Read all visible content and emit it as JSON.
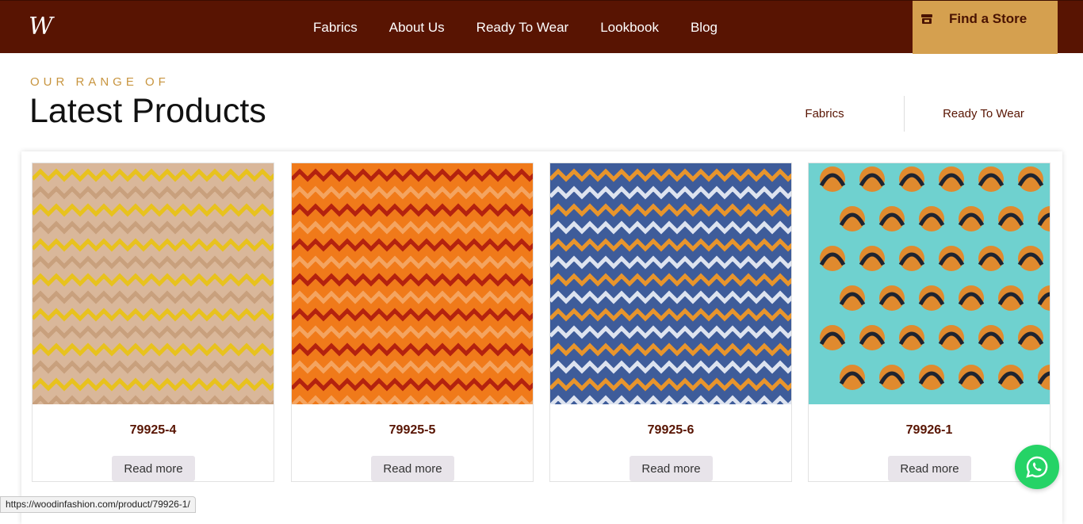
{
  "header": {
    "logo_text": "W",
    "nav": [
      "Fabrics",
      "About Us",
      "Ready To Wear",
      "Lookbook",
      "Blog"
    ],
    "store_button": "Find a Store",
    "store_icon": "store-icon"
  },
  "section": {
    "eyebrow": "OUR RANGE OF",
    "title": "Latest Products",
    "filters": [
      "Fabrics",
      "Ready To Wear"
    ]
  },
  "products": [
    {
      "name": "79925-4",
      "button": "Read more",
      "colors": [
        "#d9b79a",
        "#e8c21d",
        "#c8a07d"
      ]
    },
    {
      "name": "79925-5",
      "button": "Read more",
      "colors": [
        "#f07a1a",
        "#b3220f",
        "#f4a460"
      ]
    },
    {
      "name": "79925-6",
      "button": "Read more",
      "colors": [
        "#3e5c9a",
        "#e8952c",
        "#dde3ef"
      ]
    },
    {
      "name": "79926-1",
      "button": "Read more",
      "colors": [
        "#6fd1cf",
        "#e08a2e",
        "#1f2430"
      ]
    }
  ],
  "whatsapp_icon": "whatsapp-icon",
  "status_url": "https://woodinfashion.com/product/79926-1/"
}
